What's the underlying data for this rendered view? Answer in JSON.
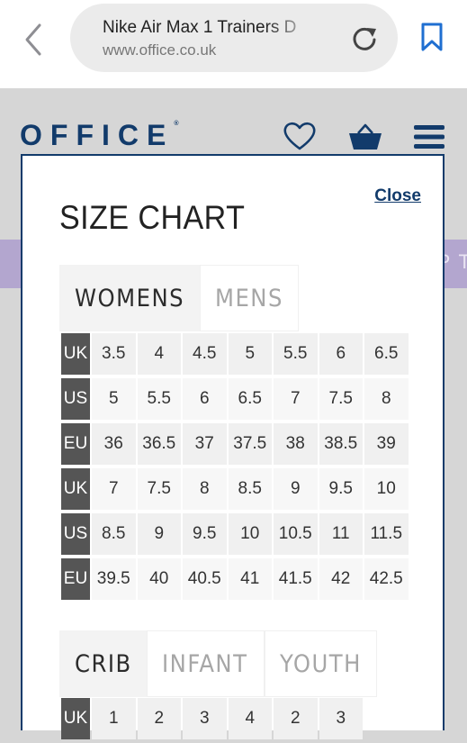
{
  "browser": {
    "page_title": "Nike Air Max 1 Trainers D",
    "domain": "www.office.co.uk",
    "back": "back",
    "reload": "reload",
    "bookmark": "bookmark"
  },
  "site": {
    "logo": "OFFICE",
    "logo_mark": "®",
    "promo_partial": "P T"
  },
  "modal": {
    "title": "SIZE CHART",
    "close": "Close",
    "tabs_primary": [
      "WOMENS",
      "MENS"
    ],
    "tabs_secondary": [
      "CRIB",
      "INFANT",
      "YOUTH"
    ],
    "table_primary": [
      {
        "label": "UK",
        "values": [
          "3.5",
          "4",
          "4.5",
          "5",
          "5.5",
          "6",
          "6.5"
        ]
      },
      {
        "label": "US",
        "values": [
          "5",
          "5.5",
          "6",
          "6.5",
          "7",
          "7.5",
          "8"
        ]
      },
      {
        "label": "EU",
        "values": [
          "36",
          "36.5",
          "37",
          "37.5",
          "38",
          "38.5",
          "39"
        ]
      },
      {
        "label": "UK",
        "values": [
          "7",
          "7.5",
          "8",
          "8.5",
          "9",
          "9.5",
          "10"
        ]
      },
      {
        "label": "US",
        "values": [
          "8.5",
          "9",
          "9.5",
          "10",
          "10.5",
          "11",
          "11.5"
        ]
      },
      {
        "label": "EU",
        "values": [
          "39.5",
          "40",
          "40.5",
          "41",
          "41.5",
          "42",
          "42.5"
        ]
      }
    ],
    "table_secondary": [
      {
        "label": "UK",
        "values": [
          "1",
          "2",
          "3",
          "4",
          "2",
          "3"
        ]
      }
    ]
  }
}
